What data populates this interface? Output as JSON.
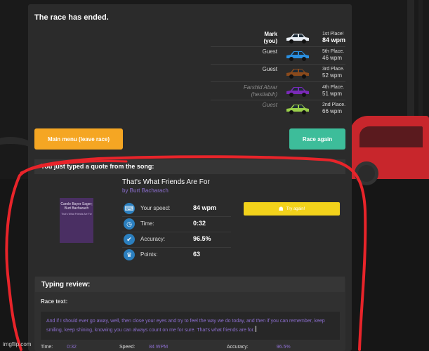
{
  "race": {
    "status": "The race has ended.",
    "racers": [
      {
        "name": "Mark\n(you)",
        "place": "1st Place!",
        "wpm": "84 wpm",
        "car_color": "#e9eef4",
        "style": "you"
      },
      {
        "name": "Guest",
        "place": "5th Place.",
        "wpm": "46 wpm",
        "car_color": "#2a8fe0",
        "style": "normal"
      },
      {
        "name": "Guest",
        "place": "3rd Place.",
        "wpm": "52 wpm",
        "car_color": "#8a4a1c",
        "style": "normal"
      },
      {
        "name": "Farshid Abrar\n(hestiabih)",
        "place": "4th Place.",
        "wpm": "51 wpm",
        "car_color": "#7a2ab8",
        "style": "faded"
      },
      {
        "name": "Guest",
        "place": "2nd Place.",
        "wpm": "66 wpm",
        "car_color": "#9ad04a",
        "style": "faded"
      }
    ],
    "main_menu_label": "Main menu (leave race)",
    "race_again_label": "Race again"
  },
  "quote": {
    "header": "You just typed a quote from the song:",
    "song_title": "That's What Friends Are For",
    "song_artist": "by Burt Bacharach",
    "album_text": "Carole Bayer Sager; Burt Bacharach",
    "album_small": "That's What Friends Are For",
    "stats": [
      {
        "label": "Your speed:",
        "value": "84 wpm",
        "icon": "speedometer-icon",
        "glyph": "⌨"
      },
      {
        "label": "Time:",
        "value": "0:32",
        "icon": "clock-icon",
        "glyph": "◷"
      },
      {
        "label": "Accuracy:",
        "value": "96.5%",
        "icon": "check-icon",
        "glyph": "✔"
      },
      {
        "label": "Points:",
        "value": "63",
        "icon": "trophy-icon",
        "glyph": "♛"
      }
    ],
    "try_again_label": "Try again!"
  },
  "review": {
    "title": "Typing review:",
    "race_text_label": "Race text:",
    "race_text": "And if I should ever go away, well, then close your eyes and try to feel the way we do today, and then if you can remember, keep smiling, keep shining, knowing you can always count on me for sure. That's what friends are for.",
    "bottom": {
      "time_label": "Time:",
      "time_value": "0:32",
      "speed_label": "Speed:",
      "speed_value": "84 WPM",
      "accuracy_label": "Accuracy:",
      "accuracy_value": "96.5%"
    }
  },
  "watermark": "imgflip.com",
  "colors": {
    "accent_orange": "#f5a623",
    "accent_green": "#3dbd9a",
    "accent_yellow": "#f2d21b",
    "text_purple": "#8d6fd1",
    "annotation_red": "#e8242a"
  }
}
